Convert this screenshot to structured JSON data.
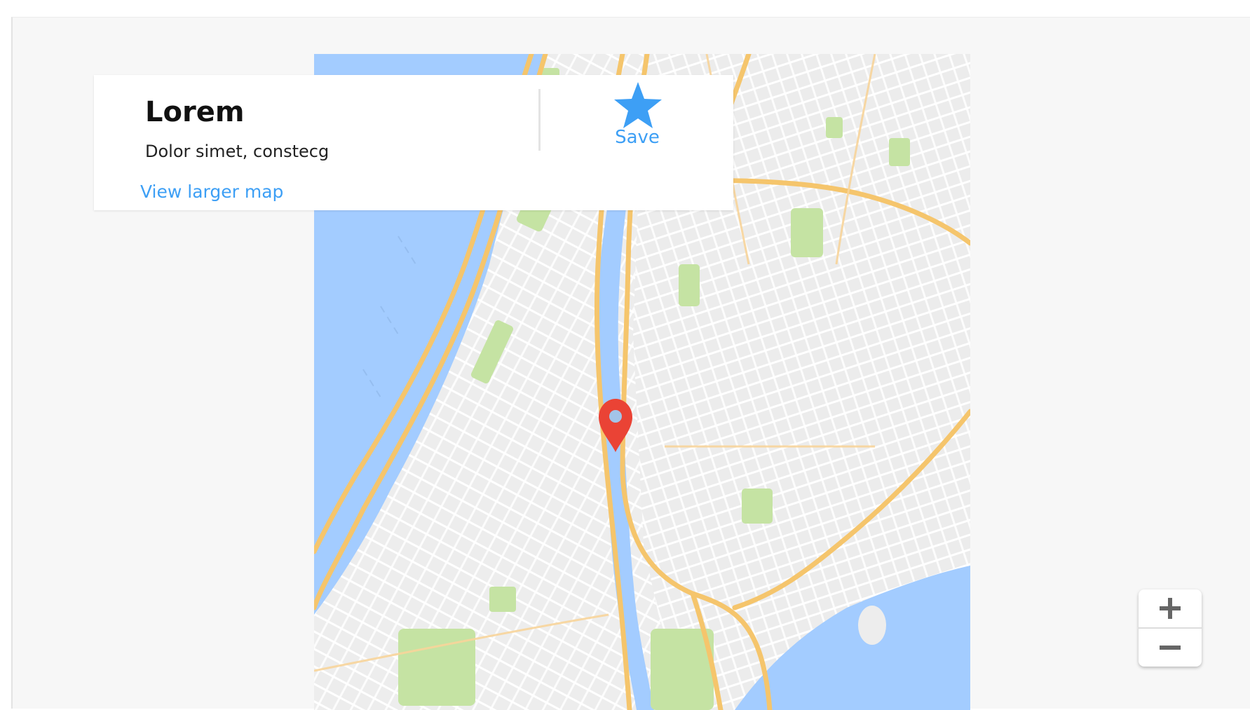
{
  "place": {
    "title": "Lorem",
    "address": "Dolor simet, constecg"
  },
  "links": {
    "view_larger": "View larger map"
  },
  "save": {
    "label": "Save"
  },
  "zoom": {
    "in_label": "+",
    "out_label": "−"
  },
  "icons": {
    "save": "star-icon",
    "marker": "location-pin-icon",
    "zoom_in": "plus-icon",
    "zoom_out": "minus-icon"
  },
  "colors": {
    "accent": "#3d9ff5",
    "marker": "#ea4335",
    "water": "#a3ccff",
    "park": "#c5e3a3",
    "highway": "#f5c56c",
    "land": "#ededed"
  }
}
